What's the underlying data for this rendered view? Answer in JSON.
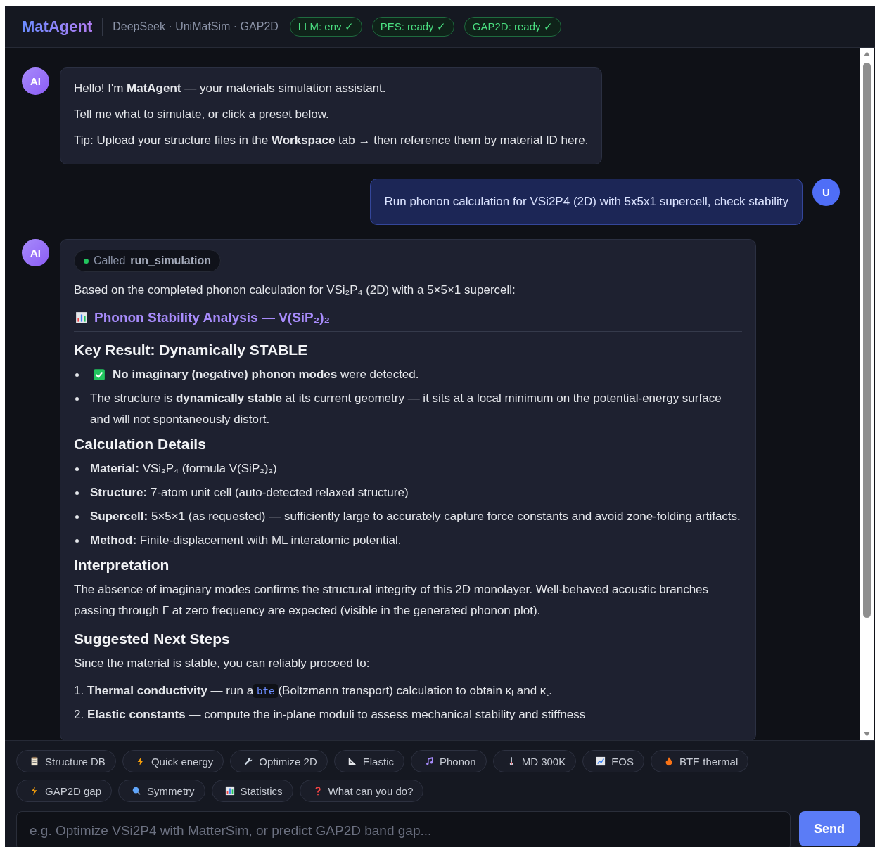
{
  "header": {
    "brand": "MatAgent",
    "subtitle": "DeepSeek · UniMatSim · GAP2D",
    "badges": [
      "LLM: env ✓",
      "PES: ready ✓",
      "GAP2D: ready ✓"
    ]
  },
  "messages": [
    {
      "kind": "assistant",
      "avatar": "AI",
      "paragraphs": [
        "Hello! I'm **MatAgent** — your materials simulation assistant.",
        "Tell me what to simulate, or click a preset below.",
        "Tip: Upload your structure files in the **Workspace** tab → then reference them by material ID here."
      ]
    },
    {
      "kind": "user",
      "avatar": "U",
      "paragraphs": [
        "Run phonon calculation for VSi2P4 (2D) with 5x5x1 supercell, check stability"
      ]
    },
    {
      "kind": "assistant",
      "avatar": "AI",
      "blocks": [
        {
          "kind": "tool_call",
          "label": "Called",
          "name": "run_simulation",
          "color": "#22c55e"
        },
        {
          "kind": "paragraph",
          "text": "Based on the completed phonon calculation for VSi₂P₄ (2D) with a 5×5×1 supercell:"
        },
        {
          "kind": "title",
          "text": "Phonon Stability Analysis — V(SiP₂)₂"
        },
        {
          "kind": "heading",
          "text": "Key Result: Dynamically STABLE"
        },
        {
          "kind": "bullets",
          "items": [
            {
              "kind": "check",
              "text": "**No imaginary (negative) phonon modes** were detected."
            },
            {
              "kind": "plain",
              "text": "The structure is **dynamically stable** at its current geometry — it sits at a local minimum on the potential-energy surface and will not spontaneously distort."
            }
          ]
        },
        {
          "kind": "heading",
          "text": "Calculation Details"
        },
        {
          "kind": "bullets",
          "items": [
            {
              "kind": "plain",
              "text": "**Material:** VSi₂P₄ (formula V(SiP₂)₂)"
            },
            {
              "kind": "plain",
              "text": "**Structure:** 7-atom unit cell (auto-detected relaxed structure)"
            },
            {
              "kind": "plain",
              "text": "**Supercell:** 5×5×1 (as requested) — sufficiently large to accurately capture force constants and avoid zone-folding artifacts."
            },
            {
              "kind": "plain",
              "text": "**Method:** Finite-displacement with ML interatomic potential."
            }
          ]
        },
        {
          "kind": "heading",
          "text": "Interpretation"
        },
        {
          "kind": "paragraph",
          "text": "The absence of imaginary modes confirms the structural integrity of this 2D monolayer. Well-behaved acoustic branches passing through Γ at zero frequency are expected (visible in the generated phonon plot)."
        },
        {
          "kind": "heading",
          "text": "Suggested Next Steps"
        },
        {
          "kind": "paragraph",
          "text": "Since the material is stable, you can reliably proceed to:"
        },
        {
          "kind": "steps",
          "items": [
            {
              "number": "1.",
              "before": "**Thermal conductivity** — run a",
              "code": "bte",
              "after": "(Boltzmann transport) calculation to obtain κₗ and κₜ."
            },
            {
              "number": "2.",
              "before": "**Elastic constants** — compute the in-plane moduli to assess mechanical stability and stiffness"
            }
          ]
        }
      ]
    }
  ],
  "presets": [
    "Structure DB",
    "Quick energy",
    "Optimize 2D",
    "Elastic",
    "Phonon",
    "MD 300K",
    "EOS",
    "BTE thermal",
    "GAP2D gap",
    "Symmetry",
    "Statistics",
    "What can you do?"
  ],
  "input": {
    "placeholder": "e.g. Optimize VSi2P4 with MatterSim, or predict GAP2D band gap..."
  },
  "send": "Send"
}
